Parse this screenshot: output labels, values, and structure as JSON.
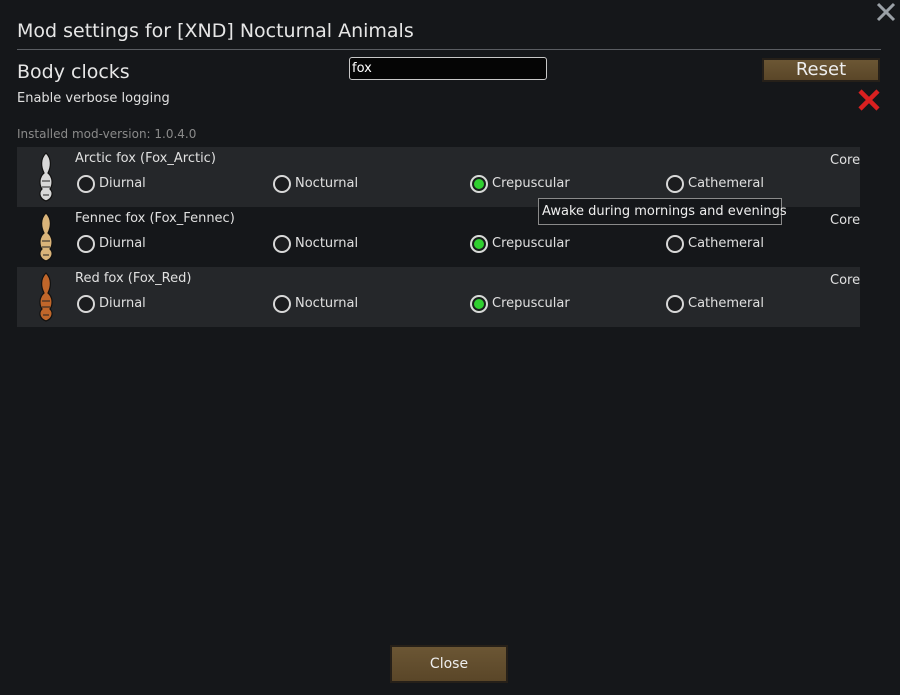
{
  "dialog": {
    "title": "Mod settings for [XND] Nocturnal Animals",
    "section_title": "Body clocks",
    "search_value": "fox",
    "reset_label": "Reset",
    "verbose_label": "Enable verbose logging",
    "version_label": "Installed mod-version: 1.0.4.0",
    "close_label": "Close",
    "close_icon": "close-x-icon",
    "clear_icon": "red-x-icon"
  },
  "options": [
    "Diurnal",
    "Nocturnal",
    "Crepuscular",
    "Cathemeral"
  ],
  "animals": [
    {
      "name": "Arctic fox (Fox_Arctic)",
      "source": "Core",
      "selected": "Crepuscular",
      "color": "#d8d8d8"
    },
    {
      "name": "Fennec fox (Fox_Fennec)",
      "source": "Core",
      "selected": "Crepuscular",
      "color": "#d9b47a"
    },
    {
      "name": "Red fox (Fox_Red)",
      "source": "Core",
      "selected": "Crepuscular",
      "color": "#c0662a"
    }
  ],
  "tooltip": "Awake during mornings and evenings"
}
